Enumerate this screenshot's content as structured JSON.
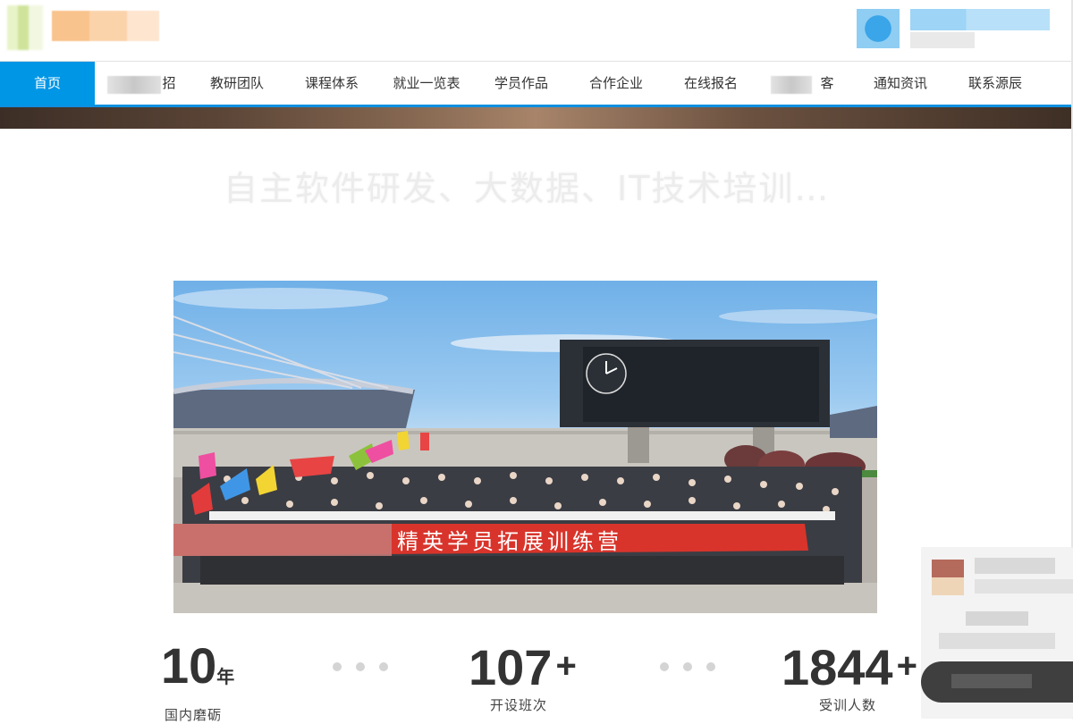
{
  "nav": {
    "items": [
      {
        "label": "首页",
        "active": true
      },
      {
        "label": "招",
        "partially_obscured": true
      },
      {
        "label": "教研团队"
      },
      {
        "label": "课程体系"
      },
      {
        "label": "就业一览表"
      },
      {
        "label": "学员作品"
      },
      {
        "label": "合作企业"
      },
      {
        "label": "在线报名"
      },
      {
        "label": "客",
        "partially_obscured": true
      },
      {
        "label": "通知资讯"
      },
      {
        "label": "联系源辰"
      }
    ],
    "accent_color": "#0096e6"
  },
  "banner": {
    "faded_heading": "自主软件研发、大数据、IT技术培训…"
  },
  "photo": {
    "banner_text": "精英学员拓展训练营"
  },
  "stats": [
    {
      "value": "10",
      "unit": "年",
      "label": "国内磨砺"
    },
    {
      "value": "107",
      "unit": "+",
      "label": "开设班次"
    },
    {
      "value": "1844",
      "unit": "+",
      "label": "受训人数"
    }
  ]
}
